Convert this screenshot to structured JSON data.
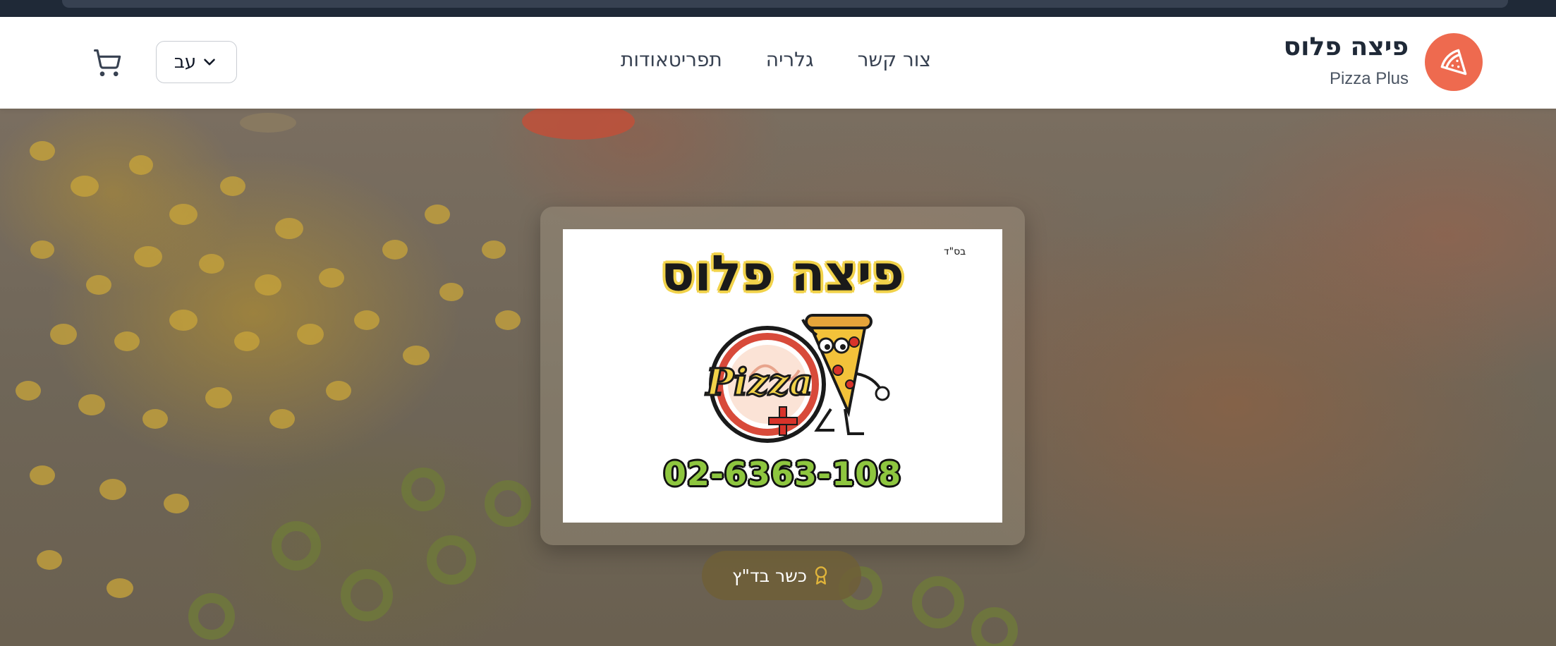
{
  "brand": {
    "name_he": "פיצה פלוס",
    "name_en": "Pizza Plus",
    "icon": "pizza-slice-icon"
  },
  "nav": {
    "items": [
      {
        "label": "תפריטאודות"
      },
      {
        "label": "גלריה"
      },
      {
        "label": "צור קשר"
      }
    ]
  },
  "language": {
    "label": "עב",
    "icon": "chevron-down-icon"
  },
  "cart": {
    "icon": "shopping-cart-icon"
  },
  "hero": {
    "logo": {
      "title": "פיצה פלוס",
      "bsd": "בס\"ד",
      "mark_text": "Pizza",
      "phone": "02-6363-108"
    },
    "kosher_badge": {
      "label": "כשר בד\"ץ",
      "icon": "award-icon"
    }
  },
  "colors": {
    "accent": "#ee6a4f",
    "top_bar": "#1f2937",
    "badge_gold": "#e0b43a",
    "phone_green": "#8ec63f",
    "logo_yellow": "#f1d24a"
  }
}
